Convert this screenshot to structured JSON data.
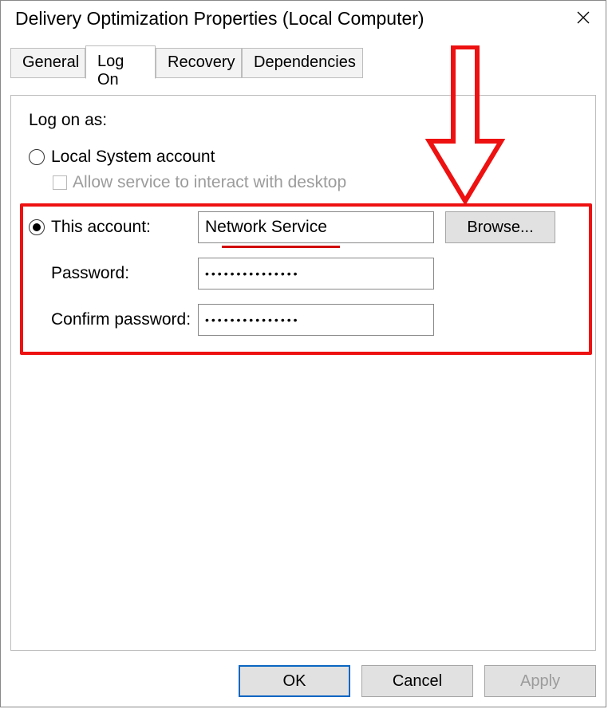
{
  "window": {
    "title": "Delivery Optimization Properties (Local Computer)"
  },
  "tabs": {
    "general": "General",
    "logon": "Log On",
    "recovery": "Recovery",
    "dependencies": "Dependencies",
    "active": "logon"
  },
  "logon": {
    "section_heading": "Log on as:",
    "local_system_label": "Local System account",
    "allow_interact_label": "Allow service to interact with desktop",
    "this_account_label": "This account:",
    "this_account_value": "Network Service",
    "password_label": "Password:",
    "password_value": "•••••••••••••••",
    "confirm_label": "Confirm password:",
    "confirm_value": "•••••••••••••••",
    "browse_label": "Browse..."
  },
  "buttons": {
    "ok": "OK",
    "cancel": "Cancel",
    "apply": "Apply"
  },
  "annotation": {
    "arrow_color": "#e11"
  }
}
